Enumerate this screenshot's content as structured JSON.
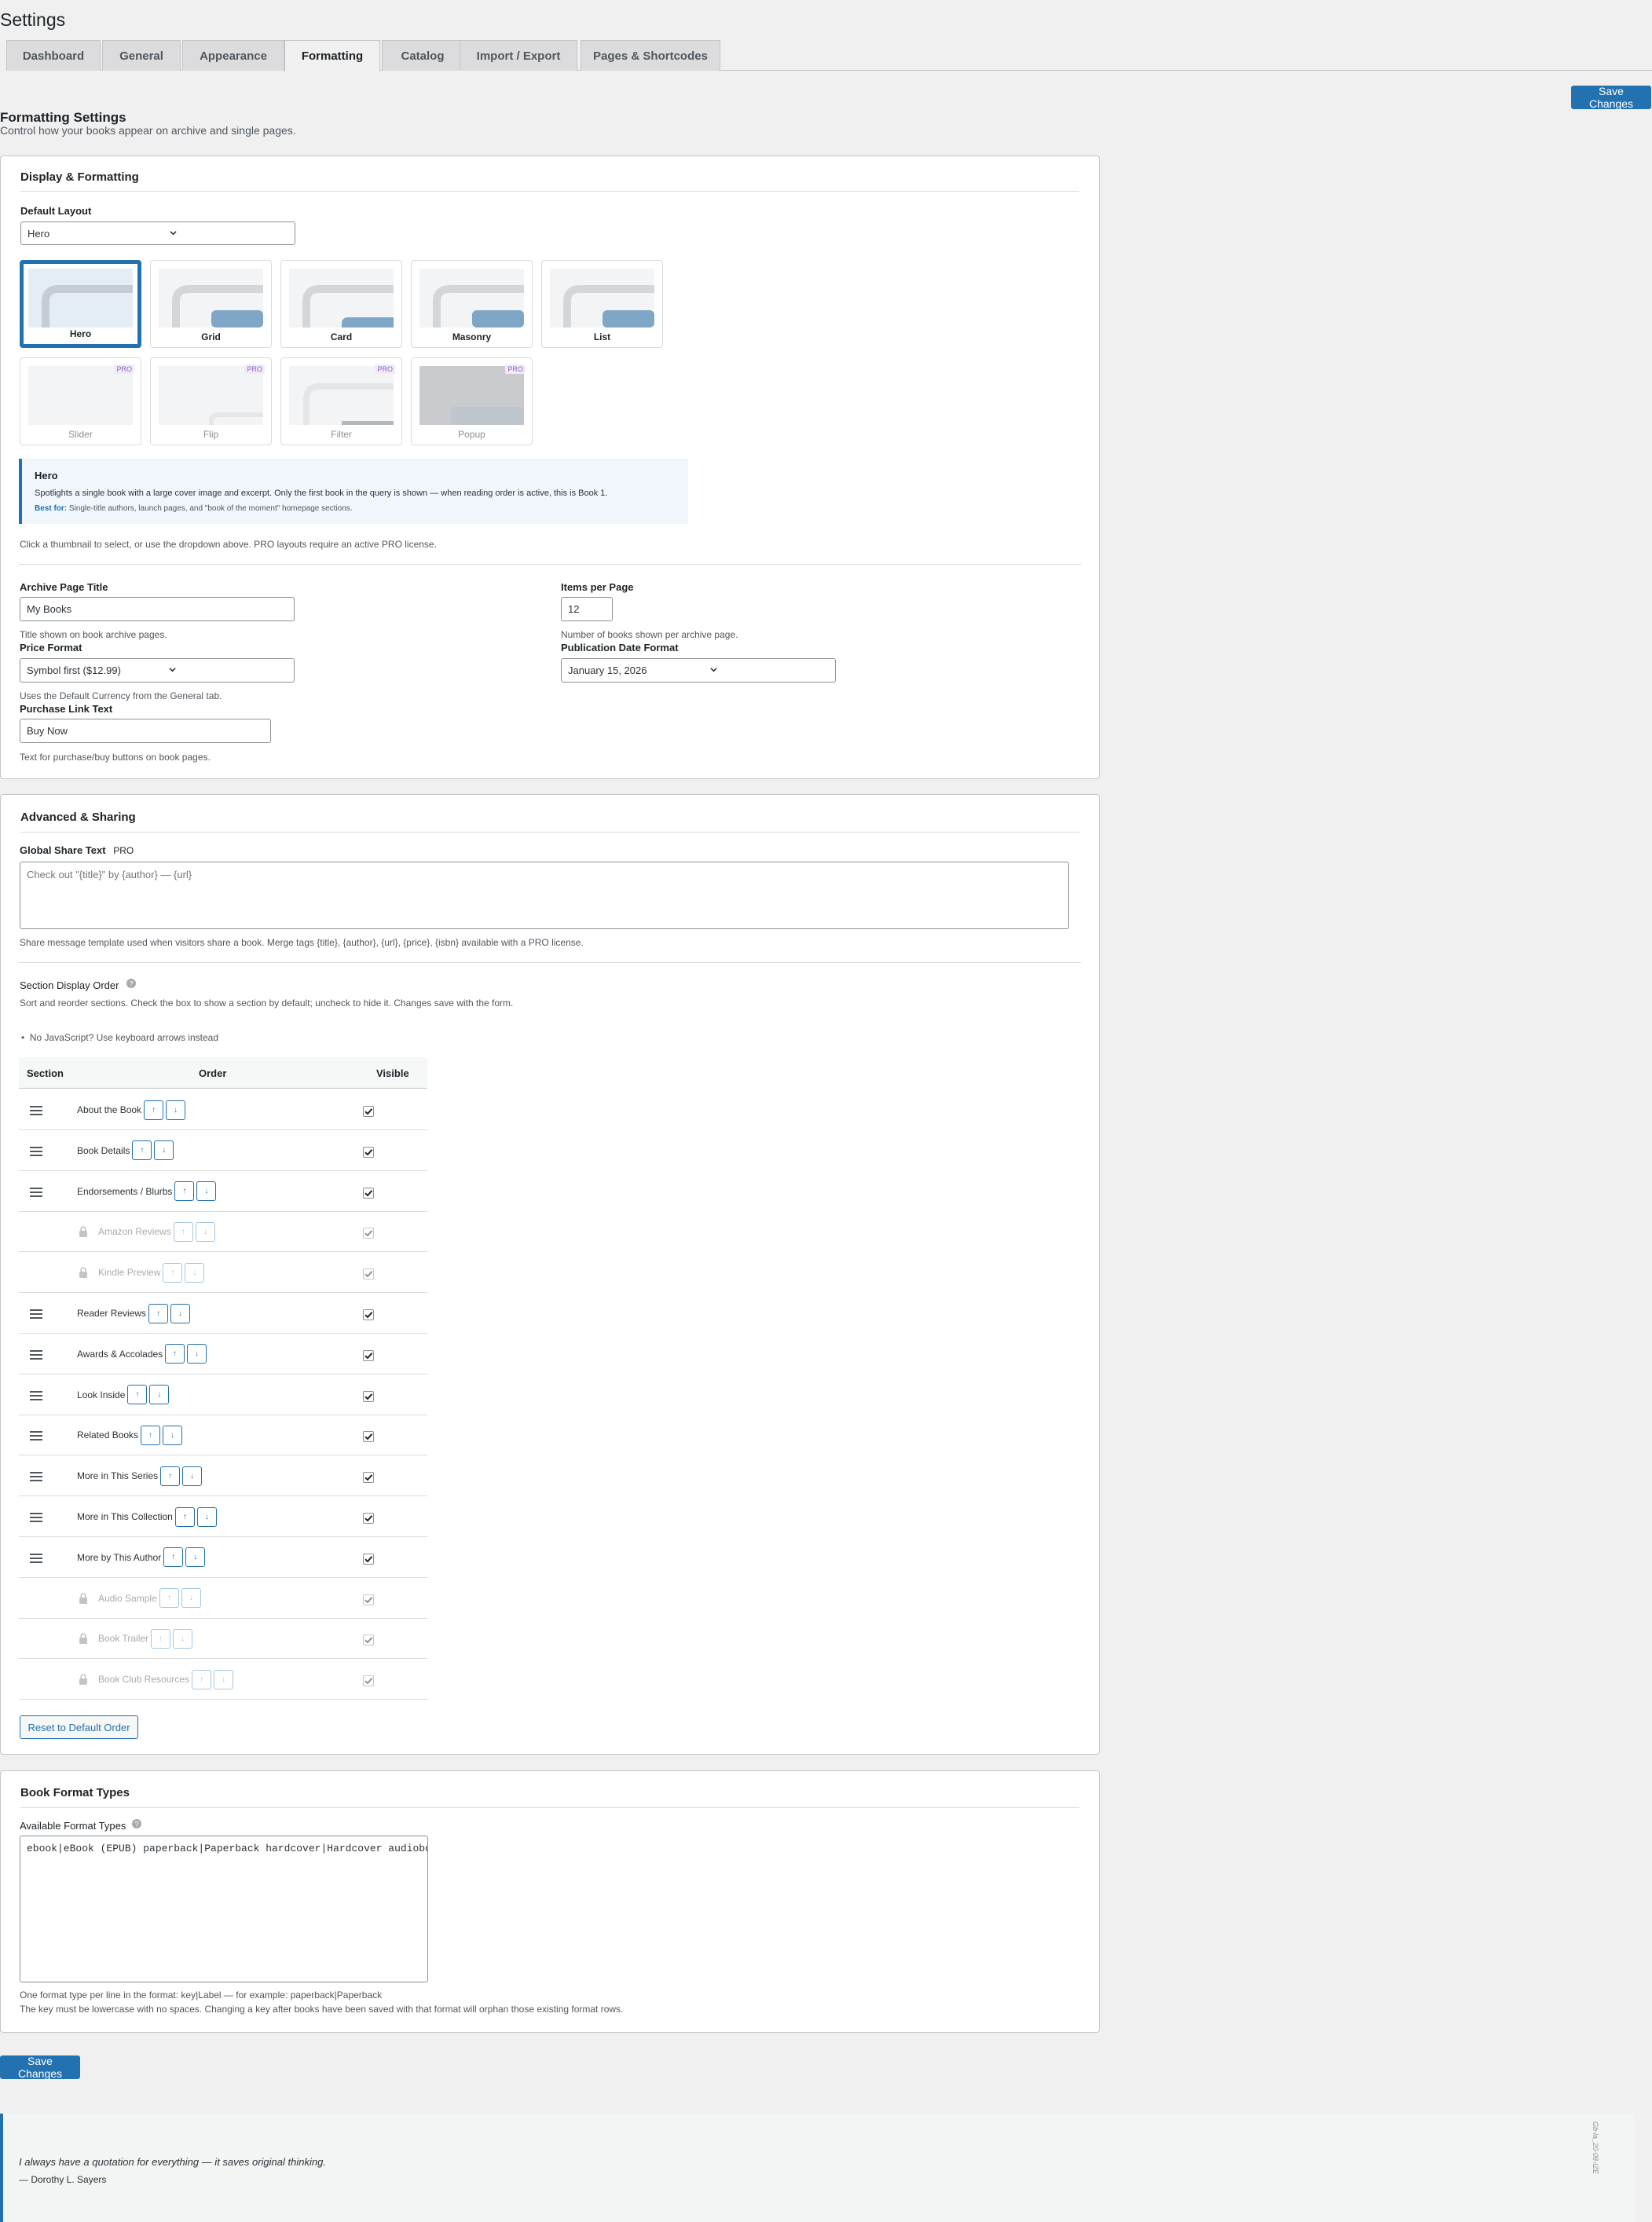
{
  "page": {
    "title": "Settings"
  },
  "tabs": [
    {
      "label": "Dashboard"
    },
    {
      "label": "General"
    },
    {
      "label": "Appearance"
    },
    {
      "label": "Formatting"
    },
    {
      "label": "Catalog"
    },
    {
      "label": "Import / Export"
    },
    {
      "label": "Pages & Shortcodes"
    }
  ],
  "active_tab": "Formatting",
  "save_label": "Save Changes",
  "formatting": {
    "heading": "Formatting Settings",
    "description": "Control how your books appear on archive and single pages."
  },
  "display": {
    "title": "Display & Formatting",
    "default_layout_label": "Default Layout",
    "default_layout_value": "Hero",
    "layouts": [
      {
        "label": "Hero",
        "selected": true,
        "pro": false
      },
      {
        "label": "Grid",
        "selected": false,
        "pro": false
      },
      {
        "label": "Card",
        "selected": false,
        "pro": false
      },
      {
        "label": "Masonry",
        "selected": false,
        "pro": false
      },
      {
        "label": "List",
        "selected": false,
        "pro": false
      },
      {
        "label": "Slider",
        "selected": false,
        "pro": true
      },
      {
        "label": "Flip",
        "selected": false,
        "pro": true
      },
      {
        "label": "Filter",
        "selected": false,
        "pro": true
      },
      {
        "label": "Popup",
        "selected": false,
        "pro": true
      }
    ],
    "pro_badge": "PRO",
    "info": {
      "title": "Hero",
      "text": "Spotlights a single book with a large cover image and excerpt. Only the first book in the query is shown — when reading order is active, this is Book 1.",
      "best_for_label": "Best for:",
      "best_for_text": "Single-title authors, launch pages, and \"book of the moment\" homepage sections."
    },
    "hint": "Click a thumbnail to select, or use the dropdown above. PRO layouts require an active PRO license.",
    "archive_title_label": "Archive Page Title",
    "archive_title_value": "My Books",
    "archive_title_desc": "Title shown on book archive pages.",
    "items_per_page_label": "Items per Page",
    "items_per_page_value": "12",
    "items_per_page_desc": "Number of books shown per archive page.",
    "price_format_label": "Price Format",
    "price_format_value": "Symbol first ($12.99)",
    "price_format_desc": "Uses the Default Currency from the General tab.",
    "pubdate_label": "Publication Date Format",
    "pubdate_value": "January 15, 2026",
    "purchase_label": "Purchase Link Text",
    "purchase_value": "Buy Now",
    "purchase_desc": "Text for purchase/buy buttons on book pages."
  },
  "advanced": {
    "title": "Advanced & Sharing",
    "share_label": "Global Share Text",
    "share_pro": "PRO",
    "share_placeholder": "Check out \"{title}\" by {author} — {url}",
    "share_desc": "Share message template used when visitors share a book. Merge tags {title}, {author}, {url}, {price}, {isbn} available with a PRO license.",
    "order_label": "Section Display Order",
    "order_desc": "Sort and reorder sections. Check the box to show a section by default; uncheck to hide it. Changes save with the form.",
    "nojs_note": "No JavaScript? Use keyboard arrows instead",
    "columns": {
      "section": "Section",
      "order": "Order",
      "visible": "Visible"
    },
    "arrow_up": "↑",
    "arrow_down": "↓",
    "rows": [
      {
        "name": "About the Book",
        "locked": false,
        "visible": true
      },
      {
        "name": "Book Details",
        "locked": false,
        "visible": true
      },
      {
        "name": "Endorsements / Blurbs",
        "locked": false,
        "visible": true
      },
      {
        "name": "Amazon Reviews",
        "locked": true,
        "visible": true
      },
      {
        "name": "Kindle Preview",
        "locked": true,
        "visible": true
      },
      {
        "name": "Reader Reviews",
        "locked": false,
        "visible": true
      },
      {
        "name": "Awards & Accolades",
        "locked": false,
        "visible": true
      },
      {
        "name": "Look Inside",
        "locked": false,
        "visible": true
      },
      {
        "name": "Related Books",
        "locked": false,
        "visible": true
      },
      {
        "name": "More in This Series",
        "locked": false,
        "visible": true
      },
      {
        "name": "More in This Collection",
        "locked": false,
        "visible": true
      },
      {
        "name": "More by This Author",
        "locked": false,
        "visible": true
      },
      {
        "name": "Audio Sample",
        "locked": true,
        "visible": true
      },
      {
        "name": "Book Trailer",
        "locked": true,
        "visible": true
      },
      {
        "name": "Book Club Resources",
        "locked": true,
        "visible": true
      }
    ],
    "reset_label": "Reset to Default Order"
  },
  "formats": {
    "title": "Book Format Types",
    "label": "Available Format Types",
    "value": "ebook|eBook (EPUB) paperback|Paperback hardcover|Hardcover audiobook|Audiobook",
    "desc1": "One format type per line in the format: key|Label — for example: paperback|Paperback",
    "desc2": "The key must be lowercase with no spaces. Changing a key after books have been saved with that format will orphan those existing format rows."
  },
  "quote": {
    "text": "I always have a quotation for everything — it saves original thinking.",
    "author": "— Dorothy L. Sayers",
    "side_text": "Gb-la_20-08-IZE"
  },
  "colors": {
    "accent": "#2271b1",
    "background": "#f0f0f1",
    "panel": "#ffffff",
    "border": "#c3c4c7"
  }
}
